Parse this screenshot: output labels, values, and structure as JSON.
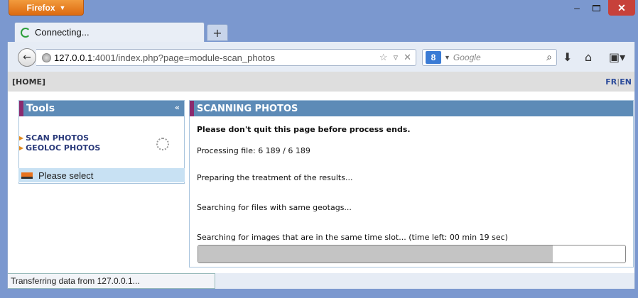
{
  "browser": {
    "menu_label": "Firefox",
    "tab_title": "Connecting...",
    "new_tab_label": "+",
    "url_host": "127.0.0.1",
    "url_rest": ":4001/index.php?page=module-scan_photos",
    "search_engine_letter": "8",
    "search_placeholder": "Google",
    "status": "Transferring data from 127.0.0.1..."
  },
  "header": {
    "home_label": "[HOME]",
    "lang_fr": "FR",
    "lang_sep": "|",
    "lang_en": "EN"
  },
  "tools": {
    "title": "Tools",
    "collapse_label": "«",
    "items": [
      {
        "label": "SCAN PHOTOS"
      },
      {
        "label": "GEOLOC PHOTOS"
      }
    ],
    "select_label": "Please select"
  },
  "scanning": {
    "title": "SCANNING PHOTOS",
    "warning": "Please don't quit this page before process ends.",
    "processing": "Processing file: 6 189 / 6 189",
    "preparing": "Preparing the treatment of the results...",
    "geotags": "Searching for files with same geotags...",
    "timeslot": "Searching for images that are in the same time slot... (time left: 00 min 19 sec)",
    "progress_fraction": 0.83
  }
}
